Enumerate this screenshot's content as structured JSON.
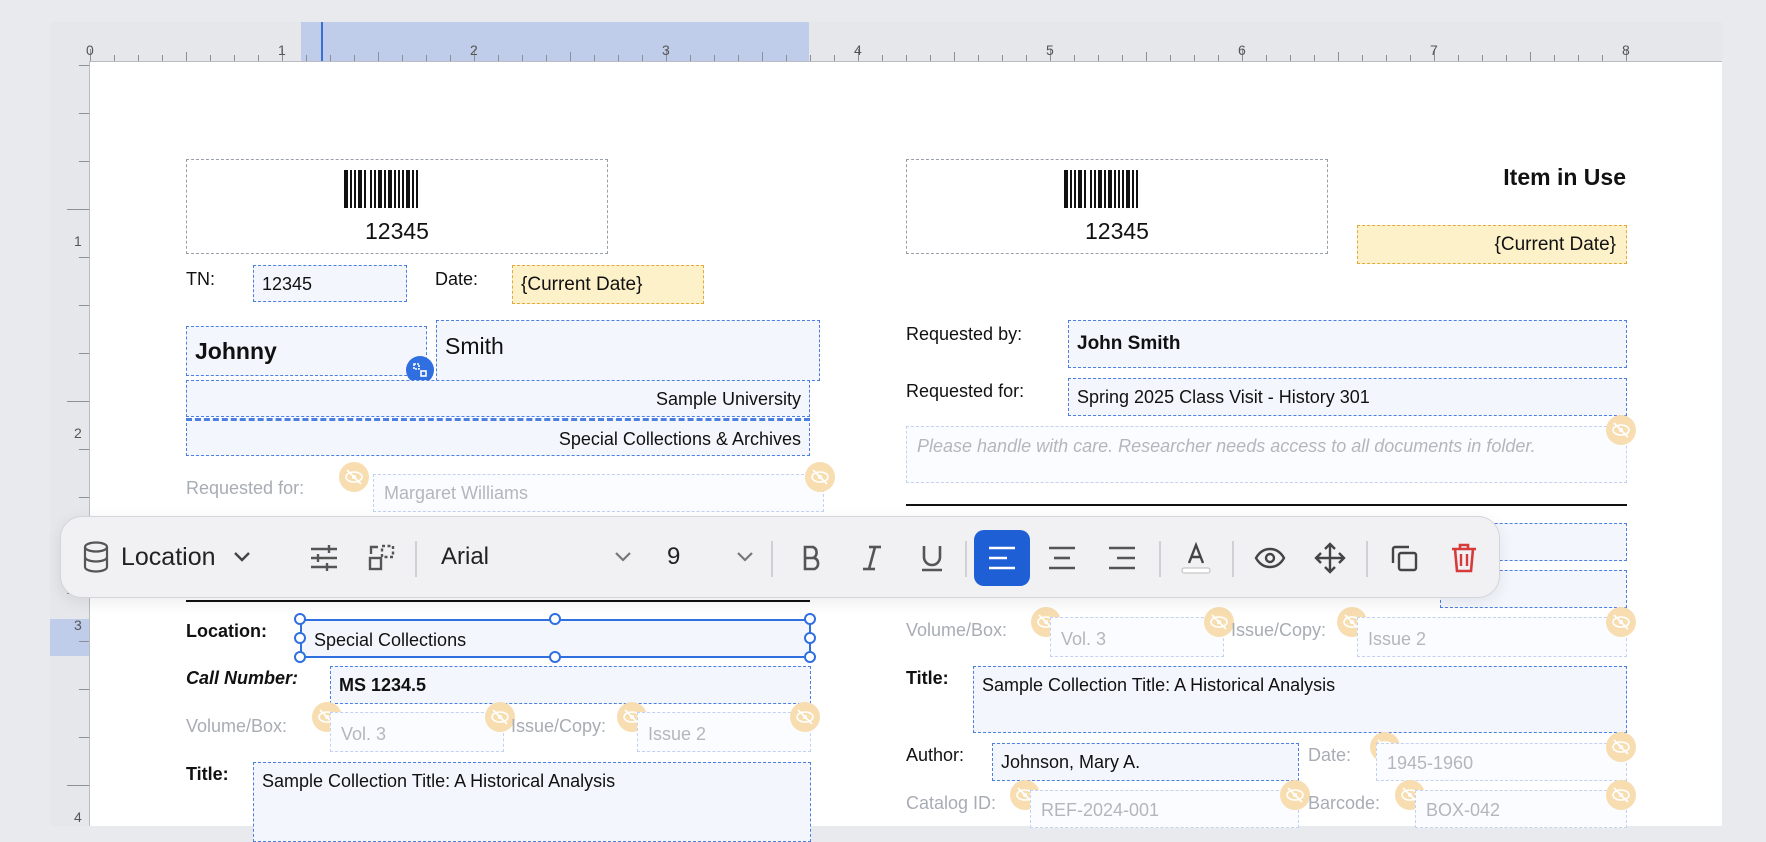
{
  "ruler": {
    "top_numbers": [
      "0",
      "1",
      "2",
      "3",
      "4",
      "5",
      "6",
      "7",
      "8"
    ],
    "left_numbers": [
      "1",
      "2",
      "3",
      "4"
    ]
  },
  "toolbar": {
    "datasource_label": "Location",
    "font_family": "Arial",
    "font_size": "9",
    "icons": [
      "database-icon",
      "chevron-down-icon",
      "sliders-icon",
      "ungroup-icon",
      "bold-icon",
      "italic-icon",
      "underline-icon",
      "align-left-icon",
      "align-center-icon",
      "align-right-icon",
      "text-color-icon",
      "eye-icon",
      "move-icon",
      "duplicate-icon",
      "trash-icon"
    ],
    "colors": {
      "active_align": "#1f5fd6",
      "delete": "#d63a3a"
    }
  },
  "left_slip": {
    "barcode_number": "12345",
    "tn_label": "TN:",
    "tn_value": "12345",
    "date_label": "Date:",
    "date_value": "{Current Date}",
    "first_name": "Johnny",
    "last_name": "Smith",
    "institution": "Sample University",
    "department": "Special Collections & Archives",
    "requested_for_label": "Requested for:",
    "requested_for_value": "Margaret Williams",
    "location_label": "Location:",
    "location_value": "Special Collections",
    "call_number_label": "Call Number:",
    "call_number_value": "MS 1234.5",
    "volume_label": "Volume/Box:",
    "volume_value": "Vol. 3",
    "issue_label": "Issue/Copy:",
    "issue_value": "Issue 2",
    "title_label": "Title:",
    "title_value": "Sample Collection Title: A Historical Analysis"
  },
  "right_slip": {
    "barcode_number": "12345",
    "heading": "Item in Use",
    "date_value": "{Current Date}",
    "requested_by_label": "Requested by:",
    "requested_by_value": "John Smith",
    "requested_for_label": "Requested for:",
    "requested_for_value": "Spring 2025 Class Visit - History 301",
    "note_placeholder": "Please handle with care. Researcher needs access to all documents in folder.",
    "volume_label": "Volume/Box:",
    "volume_value": "Vol. 3",
    "issue_label": "Issue/Copy:",
    "issue_value": "Issue 2",
    "title_label": "Title:",
    "title_value": "Sample Collection Title: A Historical Analysis",
    "author_label": "Author:",
    "author_value": "Johnson, Mary A.",
    "date_label": "Date:",
    "date_range_value": "1945-1960",
    "catalog_label": "Catalog ID:",
    "catalog_value": "REF-2024-001",
    "barcode_label": "Barcode:",
    "barcode_value": "BOX-042"
  }
}
